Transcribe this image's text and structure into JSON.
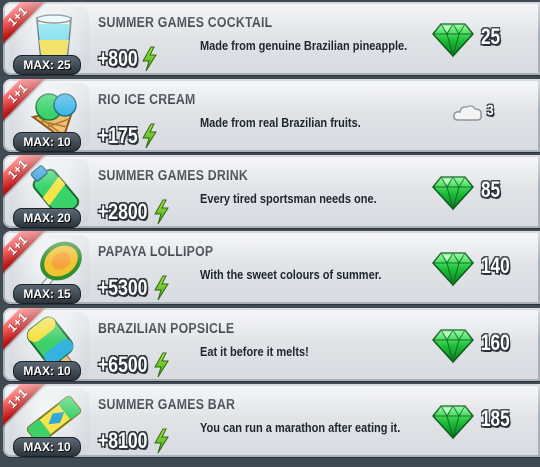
{
  "colors": {
    "ribbon": "#e01818",
    "gem": "#1fbf3a",
    "bolt": "#63c51f",
    "panel": "#e3e6ea",
    "background": "#3f4a53"
  },
  "items": [
    {
      "bonus": "1+1",
      "max": "MAX: 25",
      "name": "SUMMER GAMES COCKTAIL",
      "stat": "+800",
      "description": "Made from genuine Brazilian pineapple.",
      "price": "25",
      "currency_icon": "gem-icon",
      "art_icon": "cocktail-icon"
    },
    {
      "bonus": "1+1",
      "max": "MAX: 10",
      "name": "RIO ICE CREAM",
      "stat": "+175",
      "description": "Made from real Brazilian fruits.",
      "price": "3",
      "currency_icon": "cloud-icon",
      "art_icon": "ice-cream-icon"
    },
    {
      "bonus": "1+1",
      "max": "MAX: 20",
      "name": "SUMMER GAMES DRINK",
      "stat": "+2800",
      "description": "Every tired sportsman needs one.",
      "price": "85",
      "currency_icon": "gem-icon",
      "art_icon": "sports-bottle-icon"
    },
    {
      "bonus": "1+1",
      "max": "MAX: 15",
      "name": "PAPAYA LOLLIPOP",
      "stat": "+5300",
      "description": "With the sweet colours of summer.",
      "price": "140",
      "currency_icon": "gem-icon",
      "art_icon": "lollipop-icon"
    },
    {
      "bonus": "1+1",
      "max": "MAX: 10",
      "name": "BRAZILIAN POPSICLE",
      "stat": "+6500",
      "description": "Eat it before it melts!",
      "price": "160",
      "currency_icon": "gem-icon",
      "art_icon": "popsicle-icon"
    },
    {
      "bonus": "1+1",
      "max": "MAX: 10",
      "name": "SUMMER GAMES BAR",
      "stat": "+8100",
      "description": "You can run a marathon after eating it.",
      "price": "185",
      "currency_icon": "gem-icon",
      "art_icon": "energy-bar-icon"
    }
  ]
}
